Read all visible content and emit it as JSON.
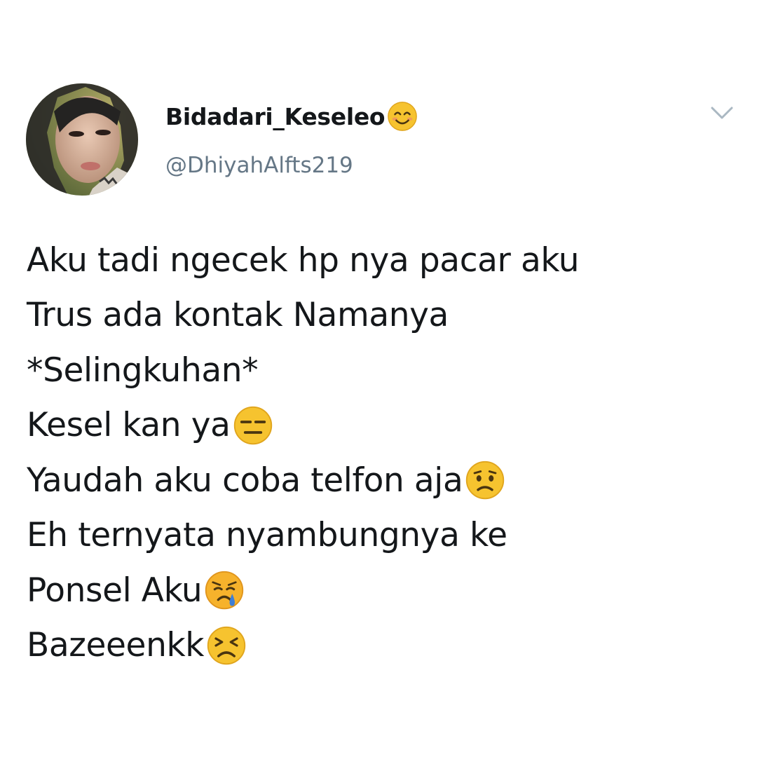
{
  "tweet": {
    "author": {
      "display_name": "Bidadari_Keseleo",
      "display_name_emoji": "smiling-face-icon",
      "handle": "@DhiyahAlfts219",
      "avatar": "profile-photo"
    },
    "menu_icon": "chevron-down-icon",
    "lines": [
      {
        "text": "Aku tadi ngecek hp nya pacar aku",
        "emoji": null
      },
      {
        "text": "Trus ada kontak Namanya",
        "emoji": null
      },
      {
        "text": "*Selingkuhan*",
        "emoji": null
      },
      {
        "text": "Kesel kan ya",
        "emoji": "expressionless-face-icon"
      },
      {
        "text": "Yaudah aku coba telfon aja",
        "emoji": "confused-face-icon"
      },
      {
        "text": "Eh ternyata nyambungnya ke",
        "emoji": null
      },
      {
        "text": "Ponsel Aku",
        "emoji": "crying-face-icon"
      },
      {
        "text": "Bazeeenkk",
        "emoji": "tired-face-icon"
      }
    ]
  },
  "colors": {
    "text_primary": "#14171a",
    "text_secondary": "#657786",
    "emoji_yellow": "#f6c32f",
    "tear_blue": "#3f7fd6"
  }
}
